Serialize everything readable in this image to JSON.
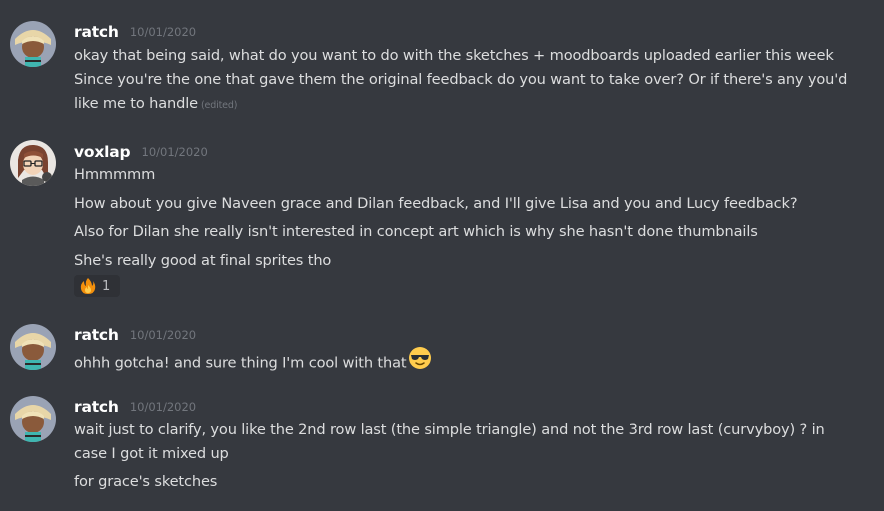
{
  "messages": [
    {
      "username": "ratch",
      "timestamp": "10/01/2020",
      "lines": [
        "okay that being said, what do you want to do with the sketches + moodboards uploaded earlier this week",
        "Since you're the one that gave them the original feedback do you want to take over? Or if there's any you'd",
        "like me to handle"
      ],
      "edited_label": "(edited)"
    },
    {
      "username": "voxlap",
      "timestamp": "10/01/2020",
      "lines": [
        "Hmmmmm",
        "How about you give Naveen grace and Dilan feedback, and I'll give Lisa and you and Lucy feedback?",
        "Also for Dilan she really isn't interested in concept art which is why she hasn't done thumbnails",
        "She's really good at final sprites tho"
      ],
      "reaction": {
        "emoji": "fire-emoji",
        "count": "1"
      }
    },
    {
      "username": "ratch",
      "timestamp": "10/01/2020",
      "lines": [
        "ohhh gotcha! and sure thing I'm cool with that"
      ],
      "inline_emoji": "sunglasses-emoji"
    },
    {
      "username": "ratch",
      "timestamp": "10/01/2020",
      "lines": [
        "wait just  to clarify, you like the 2nd row last (the simple triangle) and not the 3rd row  last (curvyboy) ? in",
        "case I got it  mixed up",
        "for grace's sketches"
      ]
    }
  ],
  "colors": {
    "background": "#36393f",
    "text": "#dcddde",
    "username": "#ffffff",
    "timestamp": "#72767d",
    "reaction_bg": "#2f3136"
  }
}
